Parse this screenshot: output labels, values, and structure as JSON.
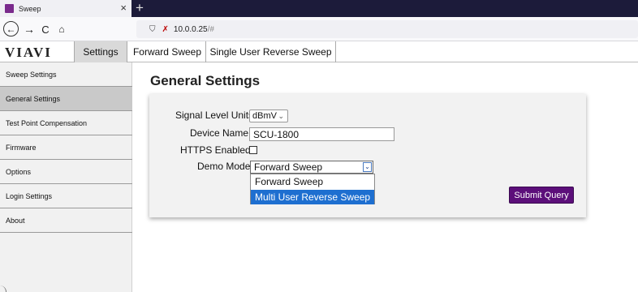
{
  "browser": {
    "tab_title": "Sweep",
    "tab_close": "×",
    "new_tab": "+",
    "favicon_color": "#7a2a8c",
    "url": "10.0.0.25",
    "url_suffix": "/#"
  },
  "nav": {
    "back_icon": "←",
    "forward_icon": "→",
    "reload_icon": "C",
    "home_icon": "⌂",
    "shield_icon": "⛉",
    "insecure_icon": "✗"
  },
  "app": {
    "logo": "VIAVI",
    "tabs": [
      "Settings",
      "Forward Sweep",
      "Single User Reverse Sweep"
    ]
  },
  "sidebar": {
    "items": [
      "Sweep Settings",
      "General Settings",
      "Test Point Compensation",
      "Firmware",
      "Options",
      "Login Settings",
      "About"
    ],
    "active": "General Settings"
  },
  "main": {
    "title": "General Settings",
    "fields": {
      "signal_level_units_label": "Signal Level Units",
      "signal_level_units_value": "dBmV",
      "device_name_label": "Device Name",
      "device_name_value": "SCU-1800",
      "https_enabled_label": "HTTPS Enabled",
      "https_enabled_checked": false,
      "demo_mode_label": "Demo Mode",
      "demo_mode_value": "Forward Sweep",
      "demo_mode_options": [
        "Forward Sweep",
        "Multi User Reverse Sweep"
      ],
      "demo_mode_highlighted": "Multi User Reverse Sweep"
    },
    "submit_label": "Submit Query",
    "submit_color": "#5c0f7a",
    "highlight_color": "#1e6fd0"
  }
}
